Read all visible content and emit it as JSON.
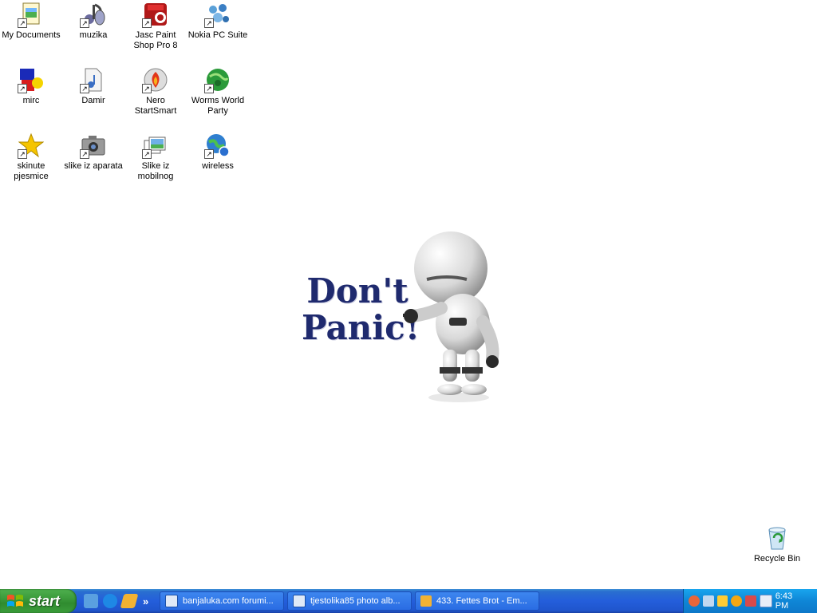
{
  "desktop": {
    "icons": [
      {
        "label": "My Documents"
      },
      {
        "label": "muzika"
      },
      {
        "label": "Jasc Paint Shop Pro 8"
      },
      {
        "label": "Nokia PC Suite"
      },
      {
        "label": "mirc"
      },
      {
        "label": "Damir"
      },
      {
        "label": "Nero StartSmart"
      },
      {
        "label": "Worms World Party"
      },
      {
        "label": "skinute pjesmice"
      },
      {
        "label": "slike iz aparata"
      },
      {
        "label": "Slike iz mobilnog"
      },
      {
        "label": "wireless"
      }
    ],
    "recycle_bin": {
      "label": "Recycle Bin"
    },
    "wallpaper": {
      "text_line1": "Don't",
      "text_line2": "Panic!"
    }
  },
  "taskbar": {
    "start_label": "start",
    "quick_launch_more": "»",
    "tasks": [
      {
        "title": "banjaluka.com forumi..."
      },
      {
        "title": "tjestolika85 photo alb..."
      },
      {
        "title": "433. Fettes Brot - Em..."
      }
    ],
    "clock": "6:43 PM"
  },
  "colors": {
    "taskbar_blue": "#245edb",
    "start_green": "#3b9a3b",
    "tray_blue": "#0f86d6",
    "wallpaper_text": "#1f2a6e"
  }
}
